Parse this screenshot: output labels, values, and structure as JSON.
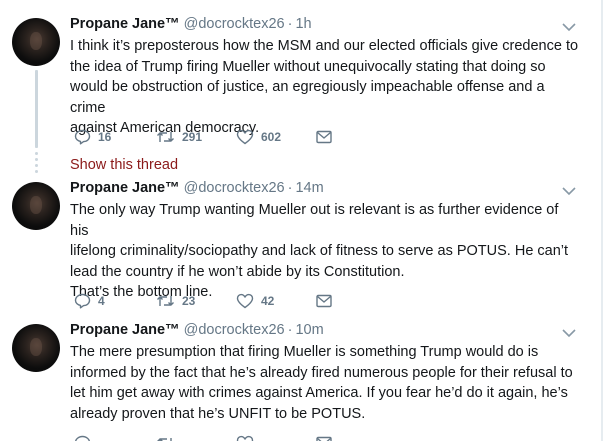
{
  "tweets": [
    {
      "name": "Propane Jane™",
      "handle": "@docrocktex26",
      "time": "1h",
      "text": "I think it’s preposterous how the MSM and our elected officials give credence to\nthe idea of Trump firing Mueller without unequivocally stating that doing so\nwould be obstruction of justice, an egregiously impeachable offense and a crime\nagainst American democracy.",
      "replies": "16",
      "retweets": "291",
      "likes": "602"
    },
    {
      "name": "Propane Jane™",
      "handle": "@docrocktex26",
      "time": "14m",
      "text": "The only way Trump wanting Mueller out is relevant is as further evidence of his\nlifelong criminality/sociopathy and lack of fitness to serve as POTUS. He can’t\nlead the country if he won’t abide by its Constitution.\nThat’s the bottom line.",
      "replies": "4",
      "retweets": "23",
      "likes": "42"
    },
    {
      "name": "Propane Jane™",
      "handle": "@docrocktex26",
      "time": "10m",
      "text": "The mere presumption that firing Mueller is something Trump would do is\ninformed by the fact that he’s already fired numerous people for their refusal to\nlet him get away with crimes against America. If you fear he’d do it again, he’s\nalready proven that he’s UNFIT to be POTUS.",
      "replies": "",
      "retweets": "",
      "likes": ""
    }
  ],
  "show_thread_label": "Show this thread",
  "separator": "·",
  "colors": {
    "show_thread": "#8b1a1a",
    "muted": "#657786",
    "thread_line": "#ccd6dd"
  }
}
